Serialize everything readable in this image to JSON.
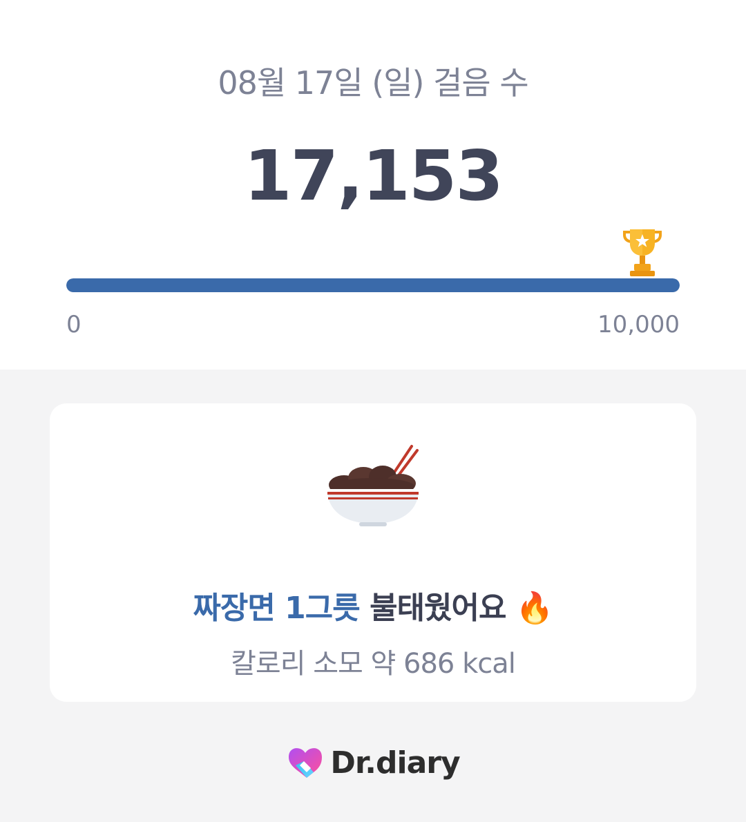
{
  "header": {
    "date_label": "08월 17일 (일) 걸음 수",
    "step_count": "17,153"
  },
  "progress": {
    "scale_min": "0",
    "scale_max": "10,000",
    "fraction_filled": 1.0,
    "bar_color": "#3a6aaa",
    "goal_icon": "trophy-icon"
  },
  "card": {
    "food_label": "짜장면 1그릇",
    "burned_label": "불태웠어요",
    "emoji": "🔥",
    "calorie_text": "칼로리 소모 약 686 kcal",
    "illustration": "jajangmyeon-bowl-icon"
  },
  "brand": {
    "name": "Dr.diary",
    "logo": "heart-logo"
  }
}
